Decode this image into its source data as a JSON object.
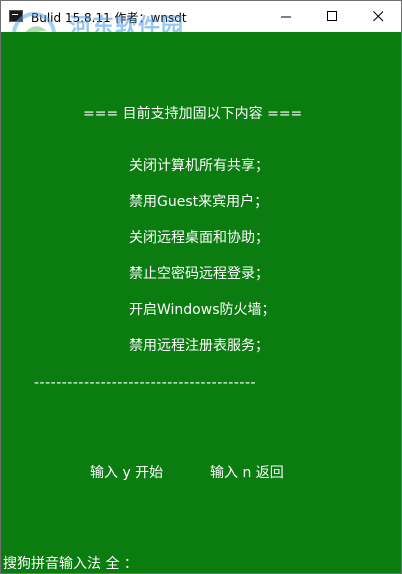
{
  "window": {
    "title": "Bulid 15.8.11   作者：wnsdt",
    "icon": "console-icon",
    "controls": {
      "minimize": "minimize-icon",
      "maximize": "maximize-icon",
      "close": "close-icon"
    }
  },
  "watermark": {
    "title": "河东软件园",
    "url": "www.pc0359.cn"
  },
  "console": {
    "background": "#0b7d10",
    "text_color": "#ffffff",
    "header": "===  目前支持加固以下内容  ===",
    "items": [
      "关闭计算机所有共享；",
      "禁用Guest来宾用户；",
      "关闭远程桌面和协助；",
      "禁止空密码远程登录；",
      "开启Windows防火墙；",
      "禁用远程注册表服务；"
    ],
    "separator": "----------------------------------------",
    "start_prompt": "输入 y 开始",
    "back_prompt": "输入 n 返回",
    "ime_status": "搜狗拼音输入法 全 ："
  }
}
